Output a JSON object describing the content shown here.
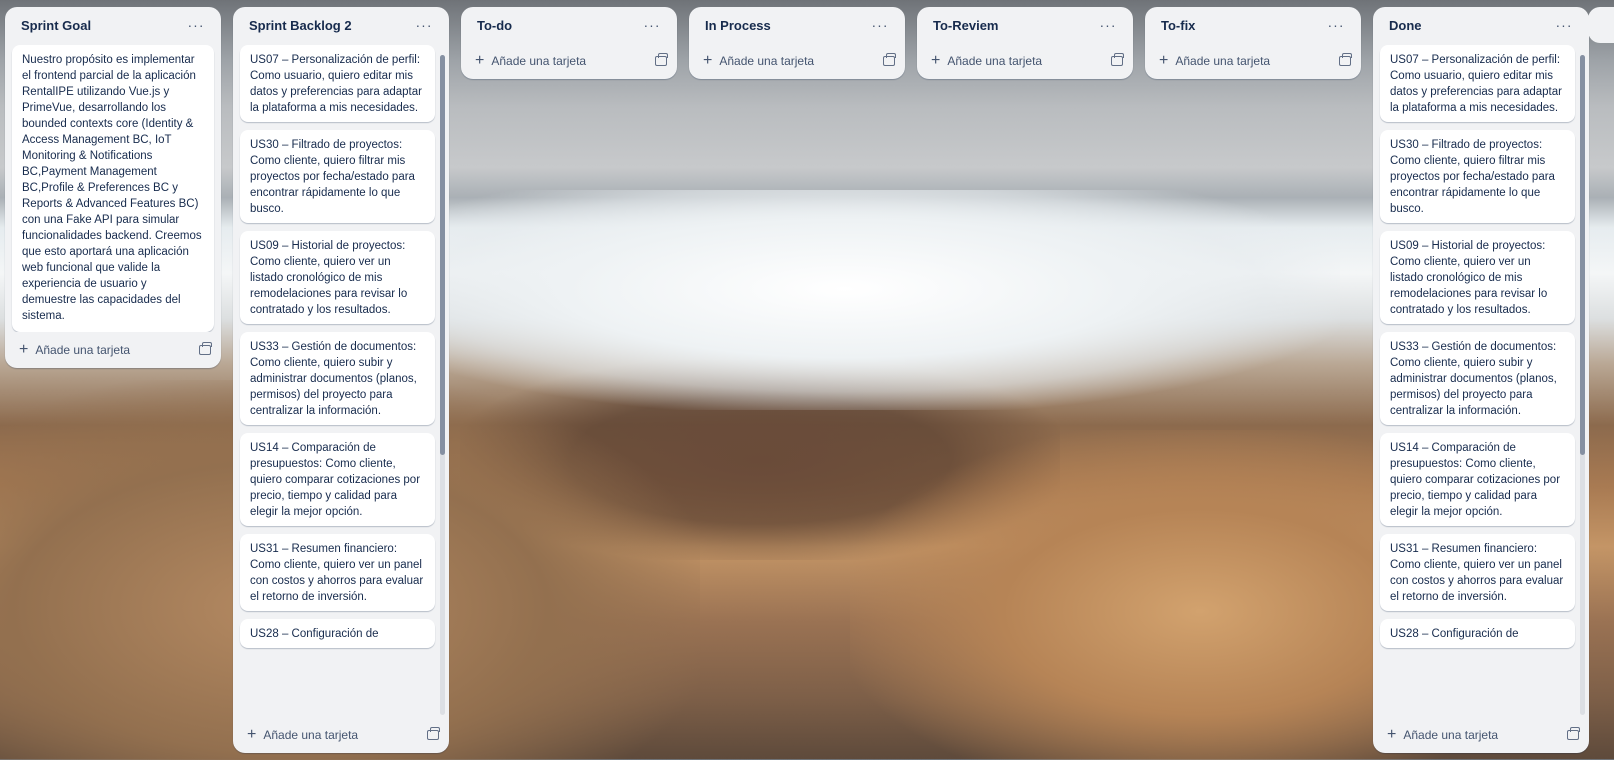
{
  "lists": [
    {
      "title": "Sprint Goal",
      "cards": [
        "Nuestro propósito es implementar el frontend parcial de la aplicación RentalIPE utilizando Vue.js y PrimeVue, desarrollando los bounded contexts core (Identity & Access Management BC, IoT Monitoring & Notifications BC,Payment Management BC,Profile & Preferences BC y Reports & Advanced Features BC) con una Fake API para simular funcionalidades backend. Creemos que esto aportará una aplicación web funcional que valide la experiencia de usuario y demuestre las capacidades del sistema."
      ],
      "add_label": "Añade una tarjeta"
    },
    {
      "title": "Sprint Backlog 2",
      "cards": [
        "US07 – Personalización de perfil: Como usuario, quiero editar mis datos y preferencias para adaptar la plataforma a mis necesidades.",
        "US30 – Filtrado de proyectos: Como cliente, quiero filtrar mis proyectos por fecha/estado para encontrar rápidamente lo que busco.",
        "US09 – Historial de proyectos: Como cliente, quiero ver un listado cronológico de mis remodelaciones para revisar lo contratado y los resultados.",
        "US33 – Gestión de documentos: Como cliente, quiero subir y administrar documentos (planos, permisos) del proyecto para centralizar la información.",
        "US14 – Comparación de presupuestos: Como cliente, quiero comparar cotizaciones por precio, tiempo y calidad para elegir la mejor opción.",
        "US31 – Resumen financiero: Como cliente, quiero ver un panel con costos y ahorros para evaluar el retorno de inversión.",
        "US28 – Configuración de"
      ],
      "add_label": "Añade una tarjeta"
    },
    {
      "title": "To-do",
      "cards": [],
      "add_label": "Añade una tarjeta"
    },
    {
      "title": "In Process",
      "cards": [],
      "add_label": "Añade una tarjeta"
    },
    {
      "title": "To-Reviem",
      "cards": [],
      "add_label": "Añade una tarjeta"
    },
    {
      "title": "To-fix",
      "cards": [],
      "add_label": "Añade una tarjeta"
    },
    {
      "title": "Done",
      "cards": [
        "US07 – Personalización de perfil: Como usuario, quiero editar mis datos y preferencias para adaptar la plataforma a mis necesidades.",
        "US30 – Filtrado de proyectos: Como cliente, quiero filtrar mis proyectos por fecha/estado para encontrar rápidamente lo que busco.",
        "US09 – Historial de proyectos: Como cliente, quiero ver un listado cronológico de mis remodelaciones para revisar lo contratado y los resultados.",
        "US33 – Gestión de documentos: Como cliente, quiero subir y administrar documentos (planos, permisos) del proyecto para centralizar la información.",
        "US14 – Comparación de presupuestos: Como cliente, quiero comparar cotizaciones por precio, tiempo y calidad para elegir la mejor opción.",
        "US31 – Resumen financiero: Como cliente, quiero ver un panel con costos y ahorros para evaluar el retorno de inversión.",
        "US28 – Configuración de"
      ],
      "add_label": "Añade una tarjeta"
    }
  ],
  "icons": {
    "menu": "dots-horizontal-icon",
    "add": "plus-icon",
    "template": "card-template-icon"
  },
  "colors": {
    "list_bg": "#f1f2f4",
    "card_bg": "#ffffff",
    "text": "#172b4d",
    "subtle_text": "#44546f"
  }
}
